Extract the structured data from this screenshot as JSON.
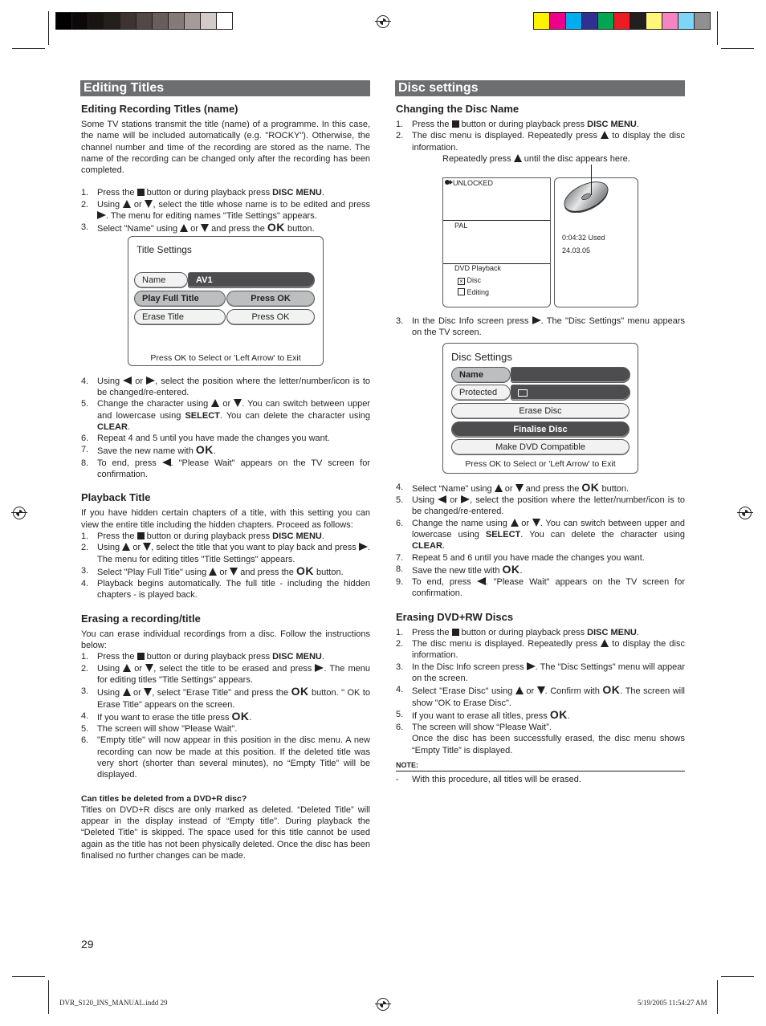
{
  "print_marks": {
    "gray_swatches": [
      "#000000",
      "#0b0a09",
      "#171413",
      "#231f1d",
      "#3d3331",
      "#524845",
      "#695e5b",
      "#857a77",
      "#a59c99",
      "#d3cbc9",
      "#ffffff"
    ],
    "color_swatches": [
      "#fff200",
      "#ec008c",
      "#00aeef",
      "#2e3192",
      "#00a651",
      "#ed1c24",
      "#231f20",
      "#fff77a",
      "#f684c4",
      "#7dd5f7",
      "#918f90"
    ]
  },
  "left": {
    "section_title": "Editing Titles",
    "editing_names": {
      "heading": "Editing Recording Titles (name)",
      "intro": "Some TV stations transmit the title (name) of a programme. In this case, the name will be included automatically (e.g. \"ROCKY\"). Otherwise, the channel number and time of the recording are stored as the name. The name of the recording can be changed only after the recording has been completed.",
      "steps_a": [
        {
          "n": "1.",
          "t1": "Press the ",
          "icon": "stop",
          "t2": " button or during playback press ",
          "b": "DISC MENU",
          "t3": "."
        },
        {
          "n": "2.",
          "t1": "Using ",
          "t2": " or ",
          "t3": ", select the title whose name is to be edited and press ",
          "t4": ". The menu for editing names \"Title Settings\" appears."
        },
        {
          "n": "3.",
          "t1": "Select \"Name\" using ",
          "t2": " or ",
          "t3": " and press the ",
          "ok": "OK",
          "t4": " button."
        }
      ],
      "screen": {
        "title": "Title Settings",
        "rows": [
          {
            "label": "Name",
            "value": "AV1"
          },
          {
            "label": "Play Full Title",
            "value": "Press OK"
          },
          {
            "label": "Erase Title",
            "value": "Press OK"
          }
        ],
        "footer": "Press OK to Select or 'Left Arrow' to Exit"
      },
      "steps_b": [
        {
          "n": "4.",
          "t1": "Using ",
          "t2": " or ",
          "t3": ", select the position where the letter/number/icon is to be changed/re-entered."
        },
        {
          "n": "5.",
          "t1": "Change the character using ",
          "t2": " or ",
          "t3": ". You can switch between upper and lowercase using ",
          "b1": "SELECT",
          "t4": ". You can delete the character using ",
          "b2": "CLEAR",
          "t5": "."
        },
        {
          "n": "6.",
          "t1": "Repeat 4 and 5 until you have made the changes you want."
        },
        {
          "n": "7.",
          "t1": "Save the new name with ",
          "ok": "OK",
          "t2": "."
        },
        {
          "n": "8.",
          "t1": "To end, press ",
          "t2": ". \"Please Wait\" appears on the TV screen for confirmation."
        }
      ]
    },
    "playback": {
      "heading": "Playback Title",
      "intro": "If you have hidden certain chapters of a title, with this setting you can view the entire title including the hidden chapters. Proceed as follows:",
      "steps": [
        {
          "n": "1.",
          "t1": "Press the ",
          "t2": " button or during playback press ",
          "b": "DISC MENU",
          "t3": "."
        },
        {
          "n": "2.",
          "t1": "Using ",
          "t2": " or ",
          "t3": ", select the title that you want to play back and press ",
          "t4": ". The menu for editing titles \"Title Settings\" appears."
        },
        {
          "n": "3.",
          "t1": "Select \"Play Full Title\" using ",
          "t2": " or ",
          "t3": " and press the ",
          "ok": "OK",
          "t4": " button."
        },
        {
          "n": "4.",
          "t1": "Playback begins automatically. The full title - including the hidden chapters - is played back."
        }
      ]
    },
    "erasing": {
      "heading": "Erasing a recording/title",
      "intro": "You can erase individual recordings from a disc. Follow the instructions below:",
      "steps": [
        {
          "n": "1.",
          "t1": "Press the ",
          "t2": " button or during playback press ",
          "b": "DISC MENU",
          "t3": "."
        },
        {
          "n": "2.",
          "t1": "Using ",
          "t2": " or ",
          "t3": ", select the title to be erased and press ",
          "t4": ". The menu for editing titles \"Title Settings\" appears."
        },
        {
          "n": "3.",
          "t1": "Using ",
          "t2": " or ",
          "t3": ", select \"Erase Title\" and press the ",
          "ok": "OK",
          "t4": " button. \" OK to Erase Title\" appears on the screen."
        },
        {
          "n": "4.",
          "t1": "If you want to erase the title press ",
          "ok": "OK",
          "t2": "."
        },
        {
          "n": "5.",
          "t1": "The screen will show \"Please Wait\"."
        },
        {
          "n": "6.",
          "t1": "\"Empty title\" will now appear in this position in the disc menu. A new recording can now be made at this position. If the deleted title was very short (shorter than several minutes), no “Empty Title” will be displayed."
        }
      ],
      "faq_q": "Can titles be deleted from a DVD+R disc?",
      "faq_a": "Titles on DVD+R discs are only marked as deleted. “Deleted Title” will appear in the display instead of “Empty title”. During playback the “Deleted Title” is skipped. The space used for this title cannot be used again as the title has not been physically deleted. Once the disc has been finalised no further changes can be made."
    },
    "page_number": "29"
  },
  "right": {
    "section_title": "Disc settings",
    "changing": {
      "heading": "Changing the Disc Name",
      "steps_a": [
        {
          "n": "1.",
          "t1": "Press the ",
          "t2": " button or during playback press ",
          "b": "DISC MENU",
          "t3": "."
        },
        {
          "n": "2.",
          "t1": "The disc menu is displayed. Repeatedly press ",
          "t2": " to display the disc information."
        }
      ],
      "callout_1": "Repeatedly press ",
      "callout_2": " until the disc appears here.",
      "disc_info": {
        "lock_status": "UNLOCKED",
        "system": "PAL",
        "playback_label": "DVD Playback",
        "option_disc": "Disc",
        "option_disc_checked": true,
        "option_editing": "Editing",
        "option_editing_checked": false,
        "used": "0:04:32 Used",
        "date": "24.03.05"
      },
      "step_3": {
        "n": "3.",
        "t1": "In the Disc Info screen press ",
        "t2": ". The \"Disc Settings\" menu appears on the TV screen."
      },
      "screen": {
        "title": "Disc Settings",
        "name_label": "Name",
        "protected_label": "Protected",
        "buttons": [
          "Erase Disc",
          "Finalise Disc",
          "Make DVD Compatible"
        ],
        "footer": "Press OK to Select or 'Left Arrow' to Exit"
      },
      "steps_b": [
        {
          "n": "4.",
          "t1": "Select “Name” using ",
          "t2": " or ",
          "t3": " and press the ",
          "ok": "OK",
          "t4": " button."
        },
        {
          "n": "5.",
          "t1": "Using ",
          "t2": " or ",
          "t3": ", select the position where the letter/number/icon is to be changed/re-entered."
        },
        {
          "n": "6.",
          "t1": "Change the name using ",
          "t2": " or ",
          "t3": ". You can switch between upper and lowercase using ",
          "b1": "SELECT",
          "t4": ". You can delete the character using ",
          "b2": "CLEAR",
          "t5": "."
        },
        {
          "n": "7.",
          "t1": "Repeat 5 and 6 until you have made the changes you want."
        },
        {
          "n": "8.",
          "t1": "Save the new title with ",
          "ok": "OK",
          "t2": "."
        },
        {
          "n": "9.",
          "t1": "To end, press ",
          "t2": ". \"Please Wait\" appears on the TV screen for confirmation."
        }
      ]
    },
    "erasing_rw": {
      "heading": "Erasing DVD+RW Discs",
      "steps": [
        {
          "n": "1.",
          "t1": "Press the ",
          "t2": " button or during playback press ",
          "b": "DISC MENU",
          "t3": "."
        },
        {
          "n": "2.",
          "t1": "The disc menu is displayed. Repeatedly press ",
          "t2": " to display the disc information."
        },
        {
          "n": "3.",
          "t1": "In the Disc Info screen press ",
          "t2": ". The \"Disc Settings\" menu will appear on the screen."
        },
        {
          "n": "4.",
          "t1": "Select \"Erase Disc\" using ",
          "t2": " or ",
          "t3": ". Confirm with ",
          "ok": "OK",
          "t4": ". The screen will show \"OK to Erase Disc\"."
        },
        {
          "n": "5.",
          "t1": "If you want to erase all titles, press ",
          "ok": "OK",
          "t2": "."
        },
        {
          "n": "6.",
          "t1": "The screen will show “Please Wait”.",
          "t2": "Once the disc has been successfully erased, the disc menu shows “Empty Title” is displayed."
        }
      ],
      "note_label": "NOTE:",
      "note_dash": "-",
      "note_text": "With this procedure, all titles will be erased."
    }
  },
  "slug": {
    "file": "DVR_S120_INS_MANUAL.indd   29",
    "timestamp": "5/19/2005   11:54:27 AM"
  }
}
